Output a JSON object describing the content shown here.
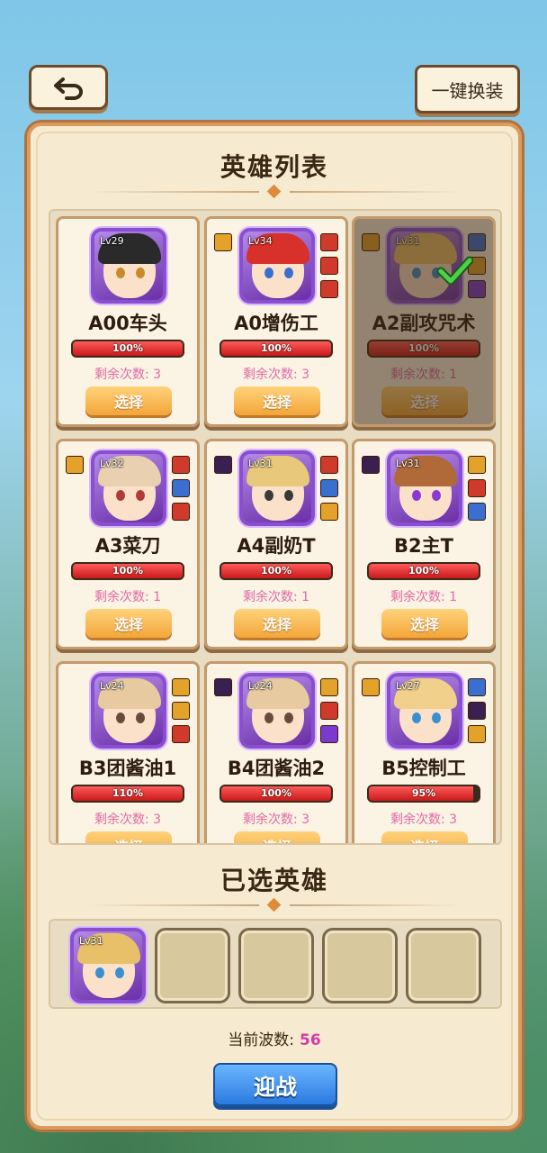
{
  "header": {
    "swap_label": "一键换装"
  },
  "hero_list": {
    "title": "英雄列表",
    "heroes": [
      {
        "name": "A00车头",
        "level": "Lv29",
        "hp": "100%",
        "hp_pct": 100,
        "remain": "剩余次数: 3",
        "select": "选择",
        "hair": "#2a2a2a",
        "eye": "#c98a2a",
        "selected": false
      },
      {
        "name": "A0增伤工",
        "level": "Lv34",
        "hp": "100%",
        "hp_pct": 100,
        "remain": "剩余次数: 3",
        "select": "选择",
        "hair": "#d8302a",
        "eye": "#3a6fd0",
        "selected": false
      },
      {
        "name": "A2副攻咒术",
        "level": "Lv31",
        "hp": "100%",
        "hp_pct": 100,
        "remain": "剩余次数: 1",
        "select": "选择",
        "hair": "#e8c06a",
        "eye": "#3a8fd0",
        "selected": true
      },
      {
        "name": "A3菜刀",
        "level": "Lv32",
        "hp": "100%",
        "hp_pct": 100,
        "remain": "剩余次数: 1",
        "select": "选择",
        "hair": "#e8d0b0",
        "eye": "#b03a3a",
        "selected": false
      },
      {
        "name": "A4副奶T",
        "level": "Lv31",
        "hp": "100%",
        "hp_pct": 100,
        "remain": "剩余次数: 1",
        "select": "选择",
        "hair": "#e8c87a",
        "eye": "#3a3a3a",
        "selected": false
      },
      {
        "name": "B2主T",
        "level": "Lv31",
        "hp": "100%",
        "hp_pct": 100,
        "remain": "剩余次数: 1",
        "select": "选择",
        "hair": "#b06a3a",
        "eye": "#8a3ad0",
        "selected": false
      },
      {
        "name": "B3团酱油1",
        "level": "Lv24",
        "hp": "110%",
        "hp_pct": 100,
        "remain": "剩余次数: 3",
        "select": "选择",
        "hair": "#e8caa0",
        "eye": "#6a4a3a",
        "selected": false
      },
      {
        "name": "B4团酱油2",
        "level": "Lv24",
        "hp": "100%",
        "hp_pct": 100,
        "remain": "剩余次数: 3",
        "select": "选择",
        "hair": "#e8caa0",
        "eye": "#6a4a3a",
        "selected": false
      },
      {
        "name": "B5控制工",
        "level": "Lv27",
        "hp": "95%",
        "hp_pct": 95,
        "remain": "剩余次数: 3",
        "select": "选择",
        "hair": "#f0d08a",
        "eye": "#3a8fd0",
        "selected": false
      }
    ]
  },
  "selected": {
    "title": "已选英雄",
    "first_level": "Lv31"
  },
  "footer": {
    "wave_label": "当前波数:",
    "wave_value": "56",
    "fight_label": "迎战"
  }
}
